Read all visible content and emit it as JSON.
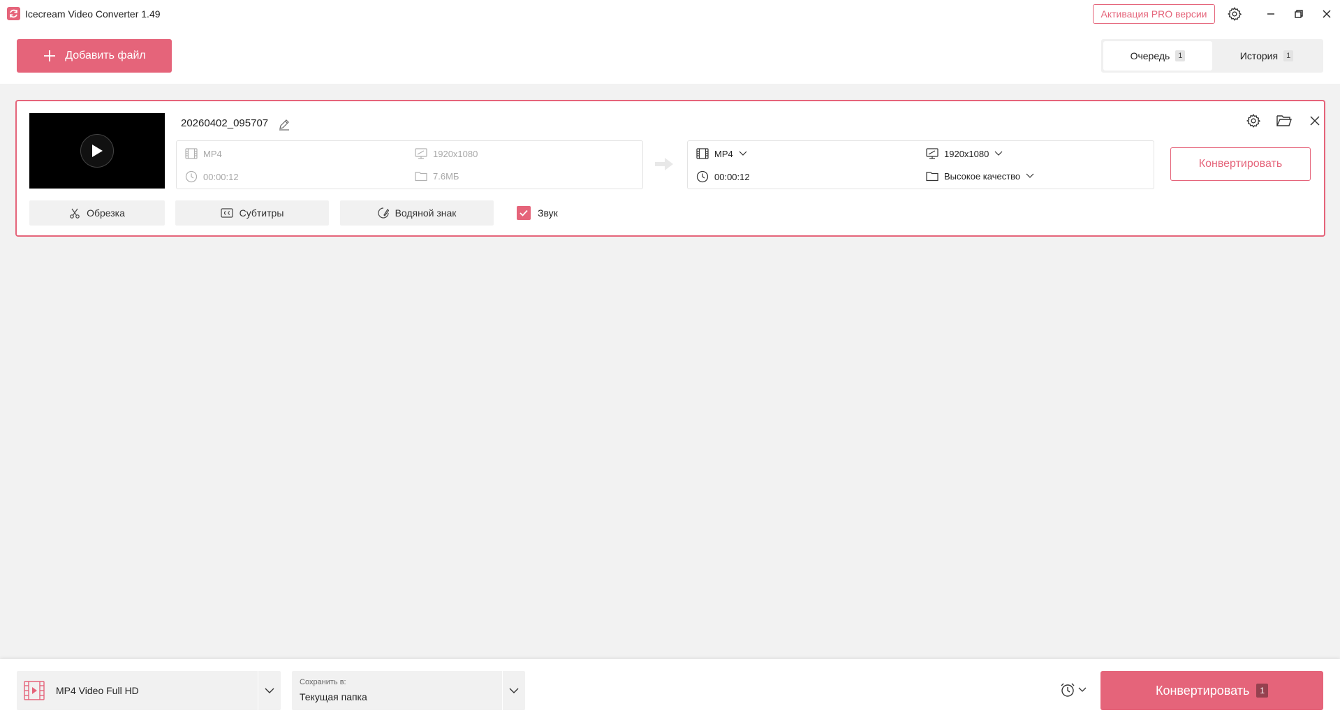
{
  "app": {
    "title": "Icecream Video Converter 1.49",
    "accent_color": "#e5647a"
  },
  "titlebar": {
    "pro_label": "Активация PRO версии",
    "icons": [
      "gear-icon",
      "minimize-icon",
      "restore-icon",
      "close-icon"
    ]
  },
  "toolbar": {
    "add_file_label": "Добавить файл",
    "tabs": [
      {
        "label": "Очередь",
        "count": "1",
        "active": true
      },
      {
        "label": "История",
        "count": "1",
        "active": false
      }
    ]
  },
  "queue_item": {
    "file_name": "20260402_095707",
    "source": {
      "format": "MP4",
      "resolution": "1920x1080",
      "duration": "00:00:12",
      "size": "7.6МБ"
    },
    "output": {
      "format": "MP4",
      "resolution": "1920x1080",
      "duration": "00:00:12",
      "quality": "Высокое качество"
    },
    "convert_label": "Конвертировать",
    "actions": {
      "trim": "Обрезка",
      "subtitles": "Субтитры",
      "watermark": "Водяной знак",
      "sound": "Звук"
    },
    "sound_checked": true
  },
  "footer": {
    "preset_label": "MP4 Video Full HD",
    "save_to_small": "Сохранить в:",
    "save_to_value": "Текущая папка",
    "convert_label": "Конвертировать",
    "convert_count": "1"
  }
}
